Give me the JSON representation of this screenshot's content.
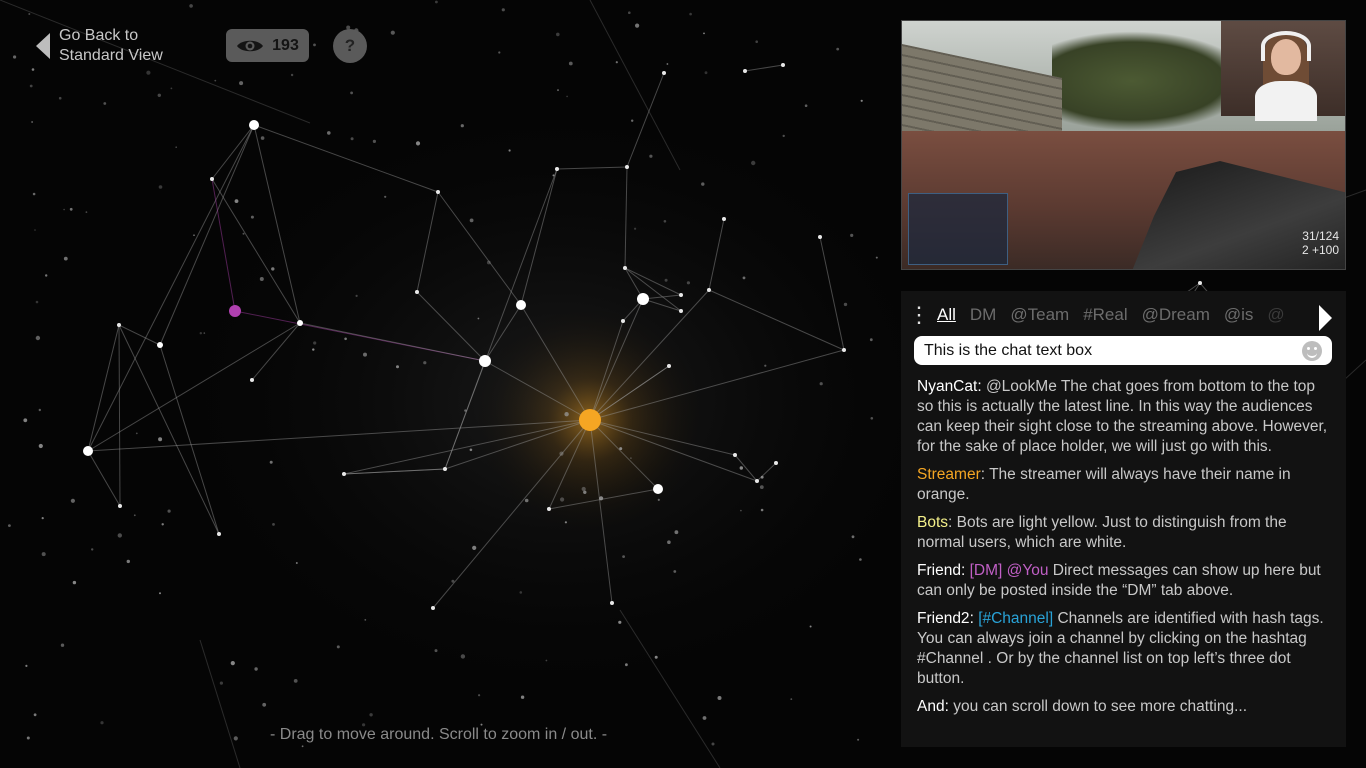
{
  "nav": {
    "back_label": "Go Back to Standard View"
  },
  "viewers": {
    "icon": "eye-icon",
    "count": "193"
  },
  "help": {
    "label": "?"
  },
  "hint": "- Drag to move around. Scroll to zoom in / out. -",
  "video": {
    "hud_ammo": "31/124",
    "hud_ammo_sub": "2 +100"
  },
  "chat": {
    "menu_icon": "⋮",
    "tabs": [
      "All",
      "DM",
      "@Team",
      "#Real",
      "@Dream",
      "@is",
      "@A"
    ],
    "active_tab": "All",
    "input_value": "This is the chat text box",
    "messages": [
      {
        "user": "NyanCat",
        "tag": "",
        "text": "@LookMe The chat goes from bottom to the top so this is actually the latest line. In this way the audiences can keep their sight close to the streaming above. However, for the sake of place holder, we will just go with this."
      },
      {
        "user": "Streamer",
        "tag": "",
        "text": "The streamer will always have their name in orange."
      },
      {
        "user": "Bots",
        "tag": "",
        "text": "Bots are light yellow. Just to distinguish from the normal users, which are white."
      },
      {
        "user": "Friend",
        "tag": "[DM] @You",
        "text": "Direct messages can show up here but can only be posted inside the “DM” tab above."
      },
      {
        "user": "Friend2",
        "tag": "[#Channel]",
        "text": "Channels are identified with hash tags. You can always join a channel by clicking on the hashtag #Channel . Or by the channel list on top left’s three dot button."
      },
      {
        "user": "And",
        "tag": "",
        "text": " you can scroll down to see more chatting..."
      }
    ]
  },
  "colors": {
    "streamer": "#f5a623",
    "bot": "#f4f08a",
    "dm": "#c05fc5",
    "channel": "#29a3d8",
    "sun": "#f5a623",
    "purple_node": "#b040b0"
  }
}
